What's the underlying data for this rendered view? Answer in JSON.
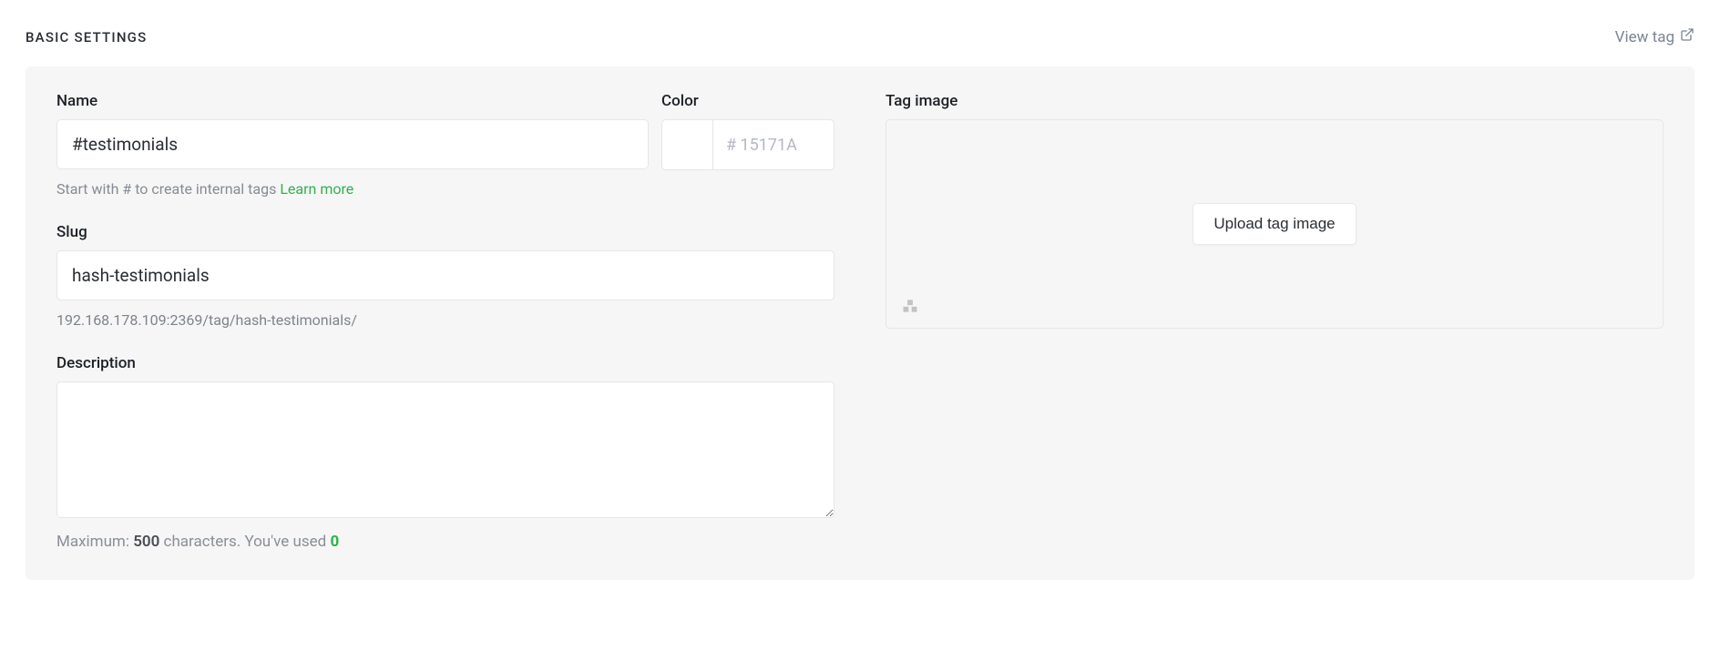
{
  "header": {
    "section_title": "BASIC SETTINGS",
    "view_tag_label": "View tag"
  },
  "form": {
    "name": {
      "label": "Name",
      "value": "#testimonials",
      "hint_prefix": "Start with # to create internal tags ",
      "hint_link": "Learn more"
    },
    "color": {
      "label": "Color",
      "value": "",
      "placeholder": "# 15171A"
    },
    "slug": {
      "label": "Slug",
      "value": "hash-testimonials",
      "url_hint": "192.168.178.109:2369/tag/hash-testimonials/"
    },
    "description": {
      "label": "Description",
      "value": "",
      "max_prefix": "Maximum: ",
      "max_value": "500",
      "max_suffix": " characters. You've used ",
      "used": "0"
    },
    "tag_image": {
      "label": "Tag image",
      "button": "Upload tag image"
    }
  }
}
